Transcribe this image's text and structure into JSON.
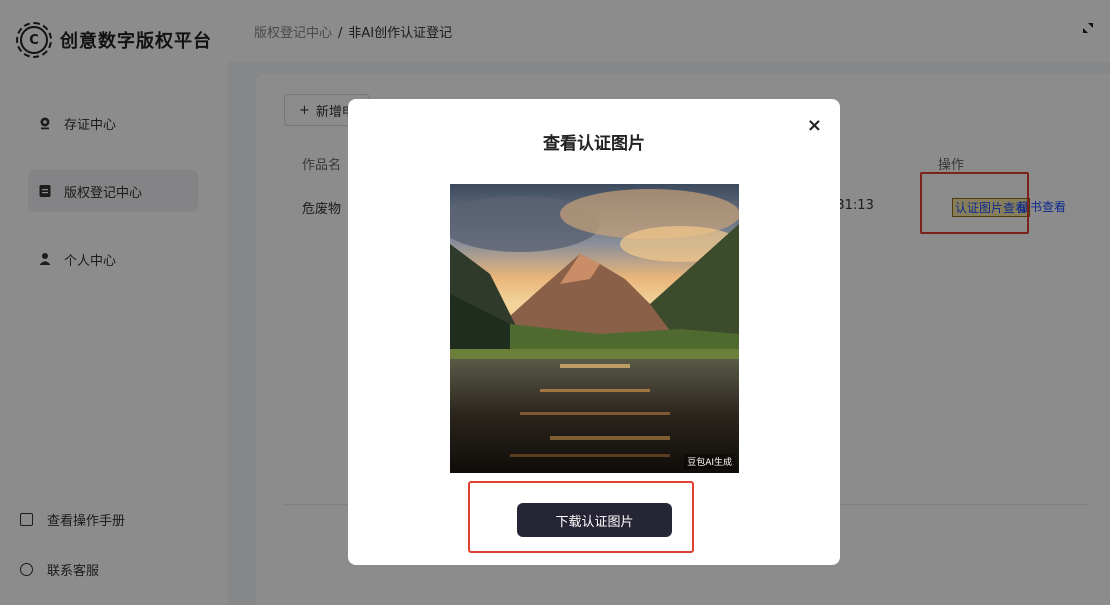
{
  "app": {
    "title": "创意数字版权平台",
    "logo_letter": "C"
  },
  "sidebar": {
    "items": [
      {
        "label": "存证中心",
        "icon": "location-pin-icon"
      },
      {
        "label": "版权登记中心",
        "icon": "document-icon",
        "active": true
      },
      {
        "label": "个人中心",
        "icon": "user-icon"
      }
    ],
    "bottom": [
      {
        "label": "查看操作手册",
        "icon": "manual-icon"
      },
      {
        "label": "联系客服",
        "icon": "chat-icon"
      }
    ]
  },
  "breadcrumb": {
    "parent": "版权登记中心",
    "separator": "/",
    "current": "非AI创作认证登记"
  },
  "main": {
    "add_button": "新增申",
    "table": {
      "headers": {
        "work_name": "作品名",
        "operation": "操作"
      },
      "rows": [
        {
          "work_name": "危废物",
          "time_fragment": ":31:13",
          "actions": [
            "认证图片查看",
            "证书查看"
          ]
        }
      ]
    }
  },
  "modal": {
    "title": "查看认证图片",
    "close": "×",
    "image_alt": "mountain lake at sunset",
    "watermark": "豆包AI生成",
    "download_label": "下载认证图片"
  },
  "colors": {
    "accent_dark": "#262536",
    "link": "#1a4fff",
    "highlight_box": "#e04030"
  }
}
